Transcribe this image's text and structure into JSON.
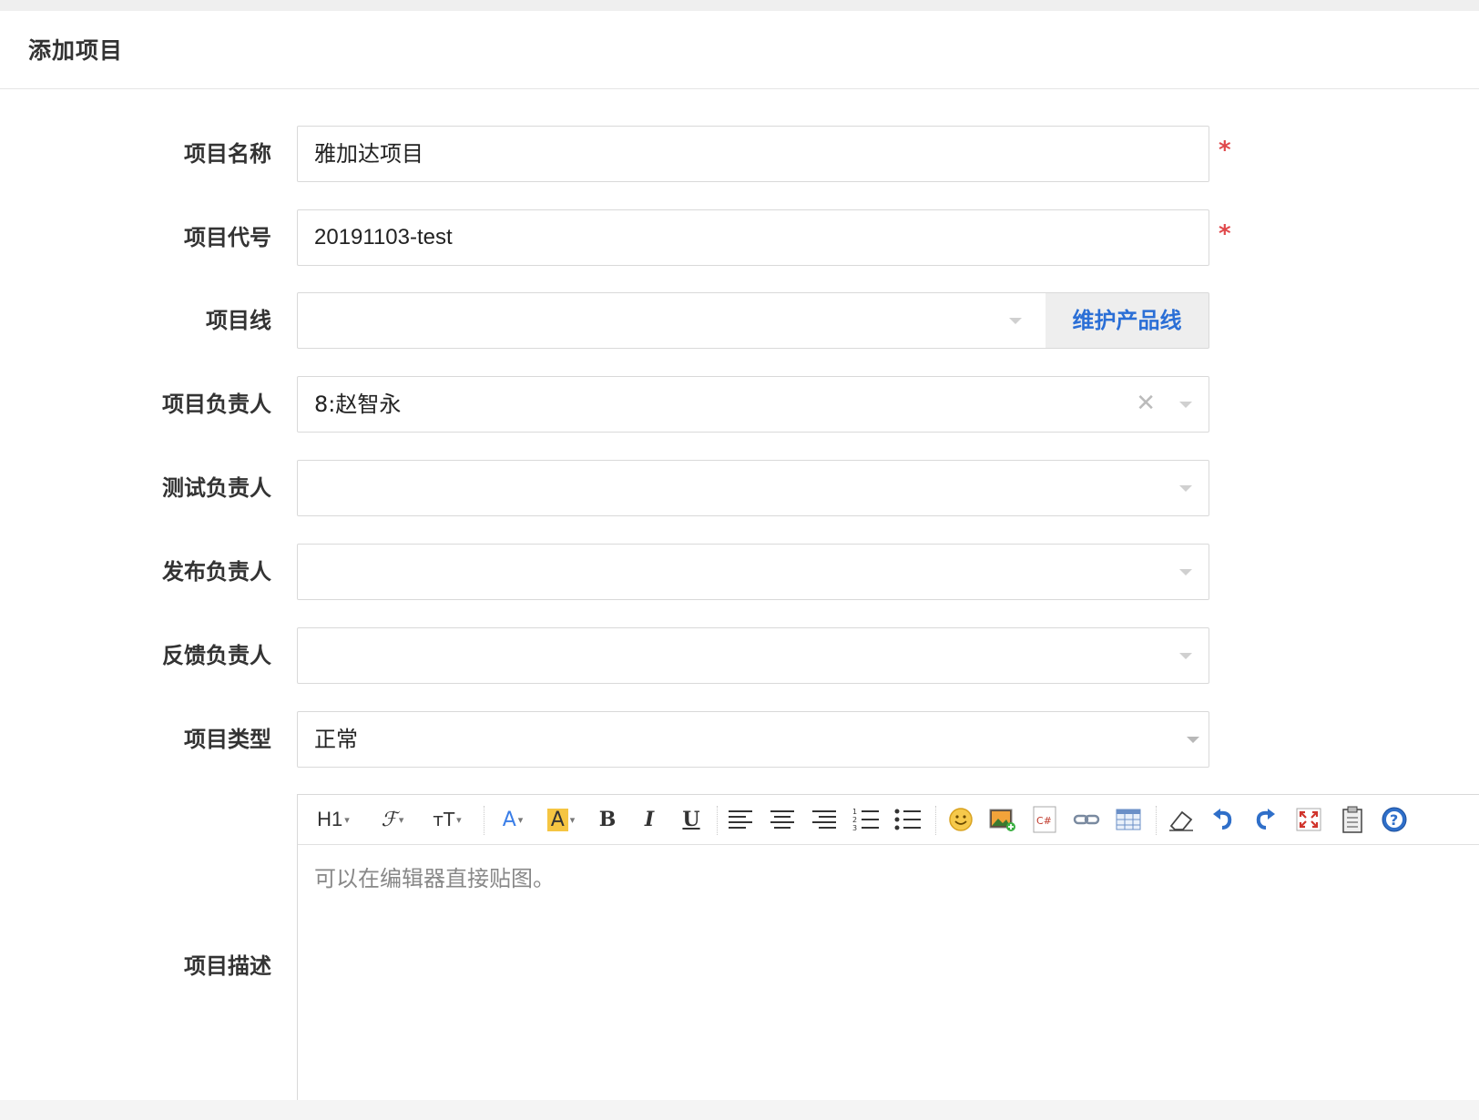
{
  "header": {
    "title": "添加项目"
  },
  "form": {
    "name": {
      "label": "项目名称",
      "value": "雅加达项目",
      "required_mark": "*"
    },
    "code": {
      "label": "项目代号",
      "value": "20191103-test",
      "required_mark": "*"
    },
    "line": {
      "label": "项目线",
      "value": "",
      "addon_label": "维护产品线"
    },
    "owner": {
      "label": "项目负责人",
      "value": "8:赵智永"
    },
    "tester": {
      "label": "测试负责人",
      "value": ""
    },
    "releaser": {
      "label": "发布负责人",
      "value": ""
    },
    "feedback": {
      "label": "反馈负责人",
      "value": ""
    },
    "type": {
      "label": "项目类型",
      "value": "正常"
    },
    "description": {
      "label": "项目描述",
      "placeholder": "可以在编辑器直接贴图。"
    }
  },
  "editor_toolbar": {
    "heading_label": "H1",
    "font_label": "ℱ",
    "size_label": "тT",
    "font_color_label": "A",
    "bg_color_label": "A",
    "bold_label": "B",
    "italic_label": "I",
    "underline_label": "U",
    "icons": [
      "heading-icon",
      "font-family-icon",
      "font-size-icon",
      "font-color-icon",
      "highlight-icon",
      "bold-icon",
      "italic-icon",
      "underline-icon",
      "align-left-icon",
      "align-center-icon",
      "align-right-icon",
      "ordered-list-icon",
      "unordered-list-icon",
      "emoji-icon",
      "image-icon",
      "code-icon",
      "link-icon",
      "table-icon",
      "eraser-icon",
      "undo-icon",
      "redo-icon",
      "fullscreen-icon",
      "paste-icon",
      "help-icon"
    ]
  },
  "colors": {
    "accent_blue": "#2b6fd6",
    "required_red": "#e0484b",
    "highlight_yellow": "#f5c542"
  }
}
